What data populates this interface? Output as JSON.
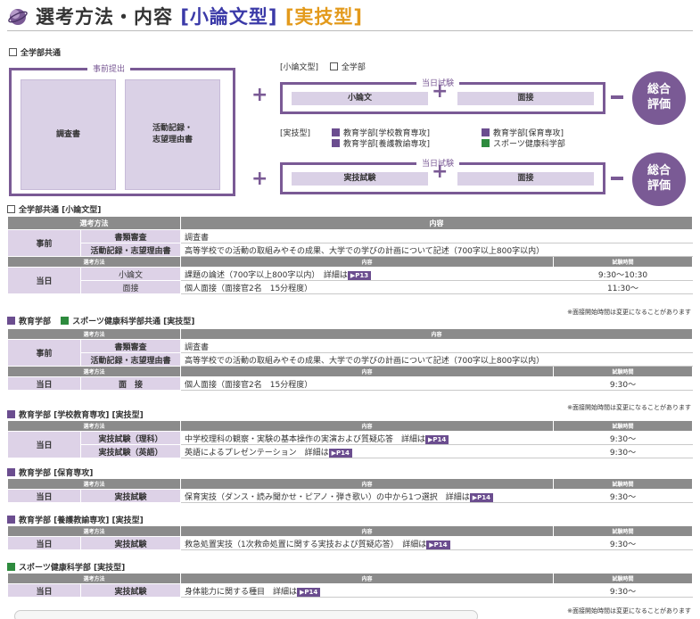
{
  "header": {
    "title_main": "選考方法・内容",
    "title_type1": "[小論文型]",
    "title_type2": "[実技型]"
  },
  "diagram": {
    "common_label": "全学部共通",
    "pre_submission_caption": "事前提出",
    "doc1": "調査書",
    "doc2_line1": "活動記録・",
    "doc2_line2": "志望理由書",
    "essay_type_label": "[小論文型]",
    "all_faculty_label": "全学部",
    "exam_day_caption": "当日試験",
    "essay": "小論文",
    "interview": "面接",
    "practical_type_label": "[実技型]",
    "practical_faculties": [
      "教育学部[学校教育専攻]",
      "教育学部[保育専攻]",
      "教育学部[養護教諭専攻]",
      "スポーツ健康科学部"
    ],
    "practical_exam": "実技試験",
    "result_line1": "総合",
    "result_line2": "評価"
  },
  "table_headers": {
    "method": "選考方法",
    "content": "内容",
    "time": "試験時間"
  },
  "sections": {
    "s1": "全学部共通 [小論文型]",
    "s2_a": "教育学部",
    "s2_b": "スポーツ健康科学部共通 [実技型]",
    "s3": "教育学部 [学校教育専攻] [実技型]",
    "s4": "教育学部 [保育専攻]",
    "s5": "教育学部 [養護教諭専攻] [実技型]",
    "s6": "スポーツ健康科学部 [実技型]"
  },
  "rows": {
    "pre": "事前",
    "day": "当日",
    "doc_review": "書類審査",
    "doc_review_content": "調査書",
    "activity": "活動記録・志望理由書",
    "activity_content": "高等学校での活動の取組みやその成果、大学での学びの計画について記述（700字以上800字以内）",
    "essay": "小論文",
    "essay_content": "課題の論述（700字以上800字以内）　詳細は",
    "essay_page": "▶P13",
    "essay_time": "9:30〜10:30",
    "interview": "面接",
    "interview_spaced": "面　接",
    "interview_content": "個人面接（面接官2名　15分程度）",
    "interview_time_1": "11:30〜",
    "time_930": "9:30〜",
    "sci_label": "実技試験（理科）",
    "sci_content": "中学校理科の観察・実験の基本操作の実演および質疑応答　詳細は",
    "eng_label": "実技試験（英語）",
    "eng_content": "英語によるプレゼンテーション　詳細は",
    "page14": "▶P14",
    "practical": "実技試験",
    "nursery_content": "保育実技（ダンス・読み聞かせ・ピアノ・弾き歌い）の中から1つ選択　詳細は",
    "nurse_content": "救急処置実技（1次救命処置に関する実技および質疑応答）　詳細は",
    "sports_content": "身体能力に関する種目　詳細は"
  },
  "note": "※面接開始時間は変更になることがあります",
  "colors": {
    "purple": "#7a5a95",
    "lavender": "#dad1e6",
    "header_gray": "#8b8b8b",
    "title_blue": "#3b3aa8",
    "title_orange": "#e39a1c",
    "green": "#2e8b3e"
  }
}
